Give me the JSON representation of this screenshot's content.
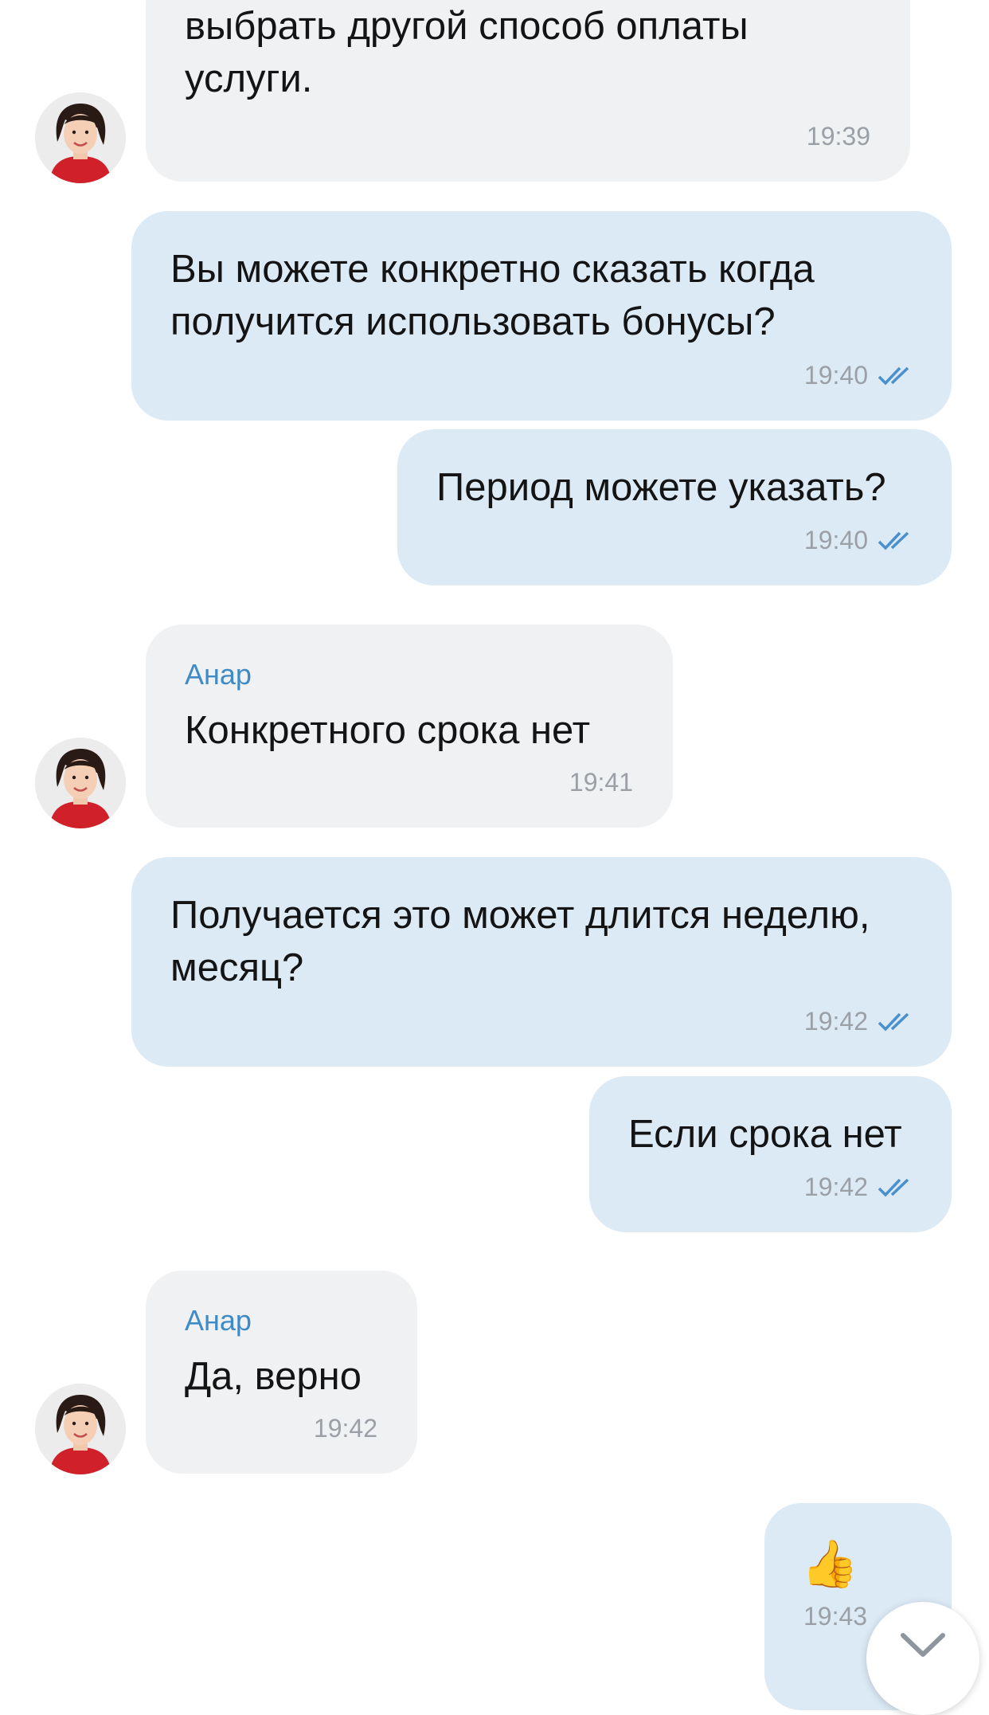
{
  "chat": {
    "messages": [
      {
        "dir": "in",
        "text_lines": [
          "выбрать другой способ оплаты",
          "услуги."
        ],
        "time": "19:39"
      },
      {
        "dir": "out",
        "text_lines": [
          "Вы можете конкретно сказать когда",
          "получится использовать бонусы?"
        ],
        "time": "19:40"
      },
      {
        "dir": "out",
        "text_lines": [
          "Период можете указать?"
        ],
        "time": "19:40"
      },
      {
        "dir": "in",
        "sender": "Анар",
        "text_lines": [
          "Конкретного срока нет"
        ],
        "time": "19:41"
      },
      {
        "dir": "out",
        "text_lines": [
          "Получается это может длится неделю,",
          "месяц?"
        ],
        "time": "19:42"
      },
      {
        "dir": "out",
        "text_lines": [
          "Если срока нет"
        ],
        "time": "19:42"
      },
      {
        "dir": "in",
        "sender": "Анар",
        "text_lines": [
          "Да, верно"
        ],
        "time": "19:42"
      },
      {
        "dir": "out",
        "emoji": "👍",
        "time": "19:43"
      }
    ]
  },
  "icons": {
    "read_receipt": "double-check-icon",
    "scroll": "chevron-down-icon",
    "avatar": "user-avatar"
  },
  "colors": {
    "incoming_bubble": "#f0f1f3",
    "outgoing_bubble": "#dceaf6",
    "sender_name": "#3f8bc6",
    "check": "#4a90cc"
  }
}
